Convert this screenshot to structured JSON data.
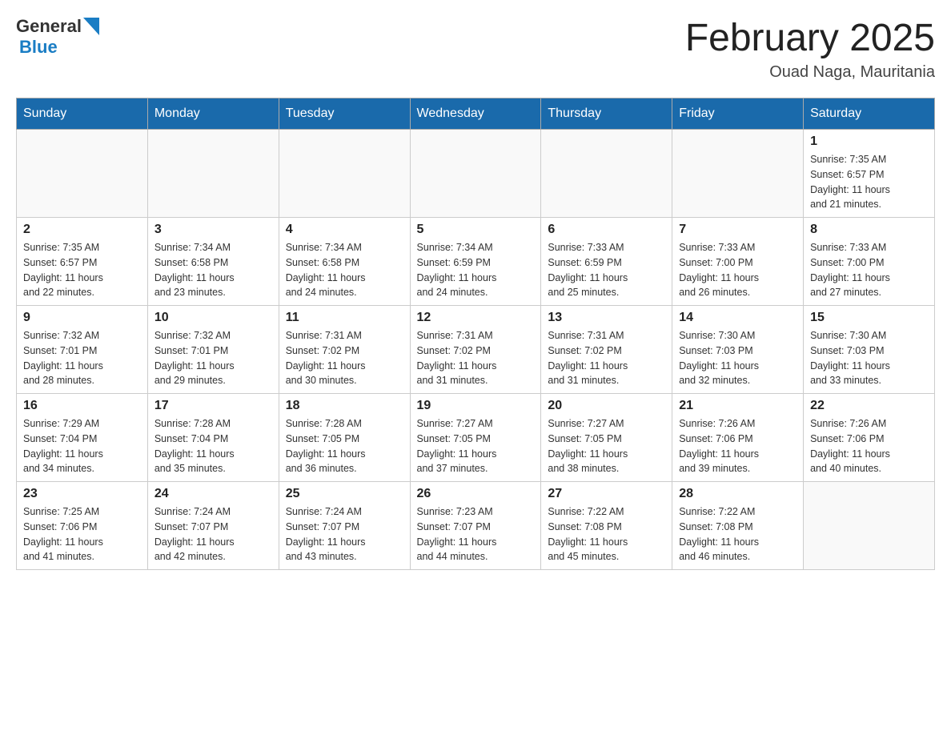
{
  "header": {
    "logo_general": "General",
    "logo_blue": "Blue",
    "title": "February 2025",
    "location": "Ouad Naga, Mauritania"
  },
  "weekdays": [
    "Sunday",
    "Monday",
    "Tuesday",
    "Wednesday",
    "Thursday",
    "Friday",
    "Saturday"
  ],
  "weeks": [
    [
      {
        "day": "",
        "info": ""
      },
      {
        "day": "",
        "info": ""
      },
      {
        "day": "",
        "info": ""
      },
      {
        "day": "",
        "info": ""
      },
      {
        "day": "",
        "info": ""
      },
      {
        "day": "",
        "info": ""
      },
      {
        "day": "1",
        "info": "Sunrise: 7:35 AM\nSunset: 6:57 PM\nDaylight: 11 hours\nand 21 minutes."
      }
    ],
    [
      {
        "day": "2",
        "info": "Sunrise: 7:35 AM\nSunset: 6:57 PM\nDaylight: 11 hours\nand 22 minutes."
      },
      {
        "day": "3",
        "info": "Sunrise: 7:34 AM\nSunset: 6:58 PM\nDaylight: 11 hours\nand 23 minutes."
      },
      {
        "day": "4",
        "info": "Sunrise: 7:34 AM\nSunset: 6:58 PM\nDaylight: 11 hours\nand 24 minutes."
      },
      {
        "day": "5",
        "info": "Sunrise: 7:34 AM\nSunset: 6:59 PM\nDaylight: 11 hours\nand 24 minutes."
      },
      {
        "day": "6",
        "info": "Sunrise: 7:33 AM\nSunset: 6:59 PM\nDaylight: 11 hours\nand 25 minutes."
      },
      {
        "day": "7",
        "info": "Sunrise: 7:33 AM\nSunset: 7:00 PM\nDaylight: 11 hours\nand 26 minutes."
      },
      {
        "day": "8",
        "info": "Sunrise: 7:33 AM\nSunset: 7:00 PM\nDaylight: 11 hours\nand 27 minutes."
      }
    ],
    [
      {
        "day": "9",
        "info": "Sunrise: 7:32 AM\nSunset: 7:01 PM\nDaylight: 11 hours\nand 28 minutes."
      },
      {
        "day": "10",
        "info": "Sunrise: 7:32 AM\nSunset: 7:01 PM\nDaylight: 11 hours\nand 29 minutes."
      },
      {
        "day": "11",
        "info": "Sunrise: 7:31 AM\nSunset: 7:02 PM\nDaylight: 11 hours\nand 30 minutes."
      },
      {
        "day": "12",
        "info": "Sunrise: 7:31 AM\nSunset: 7:02 PM\nDaylight: 11 hours\nand 31 minutes."
      },
      {
        "day": "13",
        "info": "Sunrise: 7:31 AM\nSunset: 7:02 PM\nDaylight: 11 hours\nand 31 minutes."
      },
      {
        "day": "14",
        "info": "Sunrise: 7:30 AM\nSunset: 7:03 PM\nDaylight: 11 hours\nand 32 minutes."
      },
      {
        "day": "15",
        "info": "Sunrise: 7:30 AM\nSunset: 7:03 PM\nDaylight: 11 hours\nand 33 minutes."
      }
    ],
    [
      {
        "day": "16",
        "info": "Sunrise: 7:29 AM\nSunset: 7:04 PM\nDaylight: 11 hours\nand 34 minutes."
      },
      {
        "day": "17",
        "info": "Sunrise: 7:28 AM\nSunset: 7:04 PM\nDaylight: 11 hours\nand 35 minutes."
      },
      {
        "day": "18",
        "info": "Sunrise: 7:28 AM\nSunset: 7:05 PM\nDaylight: 11 hours\nand 36 minutes."
      },
      {
        "day": "19",
        "info": "Sunrise: 7:27 AM\nSunset: 7:05 PM\nDaylight: 11 hours\nand 37 minutes."
      },
      {
        "day": "20",
        "info": "Sunrise: 7:27 AM\nSunset: 7:05 PM\nDaylight: 11 hours\nand 38 minutes."
      },
      {
        "day": "21",
        "info": "Sunrise: 7:26 AM\nSunset: 7:06 PM\nDaylight: 11 hours\nand 39 minutes."
      },
      {
        "day": "22",
        "info": "Sunrise: 7:26 AM\nSunset: 7:06 PM\nDaylight: 11 hours\nand 40 minutes."
      }
    ],
    [
      {
        "day": "23",
        "info": "Sunrise: 7:25 AM\nSunset: 7:06 PM\nDaylight: 11 hours\nand 41 minutes."
      },
      {
        "day": "24",
        "info": "Sunrise: 7:24 AM\nSunset: 7:07 PM\nDaylight: 11 hours\nand 42 minutes."
      },
      {
        "day": "25",
        "info": "Sunrise: 7:24 AM\nSunset: 7:07 PM\nDaylight: 11 hours\nand 43 minutes."
      },
      {
        "day": "26",
        "info": "Sunrise: 7:23 AM\nSunset: 7:07 PM\nDaylight: 11 hours\nand 44 minutes."
      },
      {
        "day": "27",
        "info": "Sunrise: 7:22 AM\nSunset: 7:08 PM\nDaylight: 11 hours\nand 45 minutes."
      },
      {
        "day": "28",
        "info": "Sunrise: 7:22 AM\nSunset: 7:08 PM\nDaylight: 11 hours\nand 46 minutes."
      },
      {
        "day": "",
        "info": ""
      }
    ]
  ]
}
